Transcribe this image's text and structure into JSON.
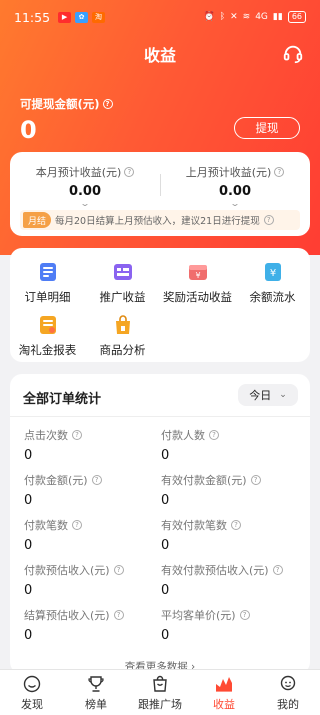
{
  "status_bar": {
    "time": "11:55",
    "battery": "66",
    "network": "4G"
  },
  "header": {
    "title": "收益"
  },
  "withdrawable": {
    "label": "可提现金额(元)",
    "amount": "0",
    "button_label": "提现"
  },
  "estimates": {
    "this_month": {
      "label": "本月预计收益(元)",
      "value": "0.00"
    },
    "last_month": {
      "label": "上月预计收益(元)",
      "value": "0.00"
    },
    "notice_tag": "月结",
    "notice_text": "每月20日结算上月预估收入，建议21日进行提现"
  },
  "menu": {
    "items": [
      {
        "label": "订单明细"
      },
      {
        "label": "推广收益"
      },
      {
        "label": "奖励活动收益"
      },
      {
        "label": "余额流水"
      },
      {
        "label": "淘礼金报表"
      },
      {
        "label": "商品分析"
      }
    ]
  },
  "stats": {
    "title": "全部订单统计",
    "period": "今日",
    "metrics": [
      {
        "label": "点击次数",
        "value": "0"
      },
      {
        "label": "付款人数",
        "value": "0"
      },
      {
        "label": "付款金额(元)",
        "value": "0"
      },
      {
        "label": "有效付款金额(元)",
        "value": "0"
      },
      {
        "label": "付款笔数",
        "value": "0"
      },
      {
        "label": "有效付款笔数",
        "value": "0"
      },
      {
        "label": "付款预估收入(元)",
        "value": "0"
      },
      {
        "label": "有效付款预估收入(元)",
        "value": "0"
      },
      {
        "label": "结算预估收入(元)",
        "value": "0"
      },
      {
        "label": "平均客单价(元)",
        "value": "0"
      }
    ],
    "more_link": "查看更多数据 ›"
  },
  "tabbar": {
    "items": [
      {
        "label": "发现"
      },
      {
        "label": "榜单"
      },
      {
        "label": "跟推广场"
      },
      {
        "label": "收益"
      },
      {
        "label": "我的"
      }
    ],
    "active": "收益"
  },
  "colors": {
    "brand": "#ff4a33",
    "gradient_start": "#ff7a2e",
    "gradient_end": "#ff3d33"
  }
}
